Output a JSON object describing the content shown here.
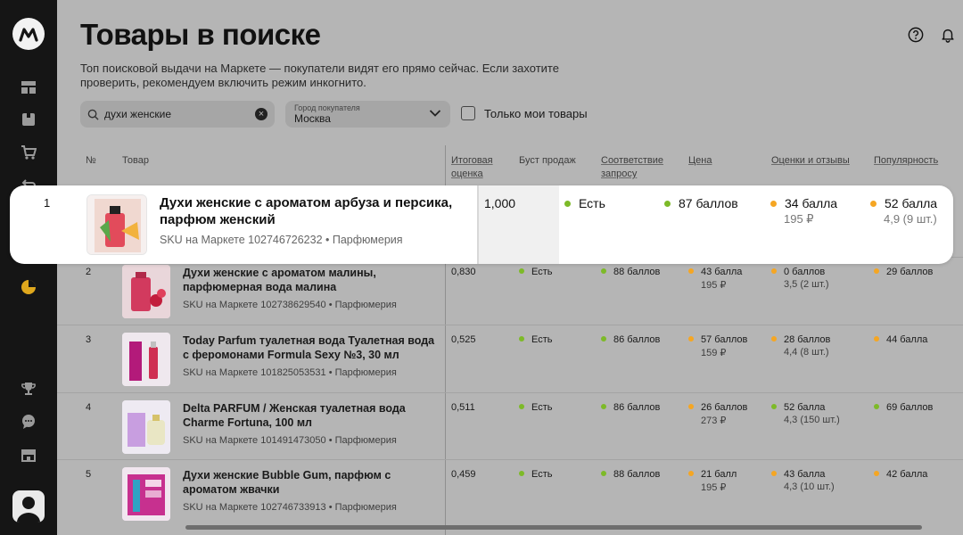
{
  "colors": {
    "green": "#7dba28",
    "orange": "#f5a623",
    "sidebar_bg": "#151515",
    "overlay_bg": "#b5b5b5"
  },
  "sidebar": {
    "logo": "yandex-market-logo",
    "items": [
      {
        "icon": "dashboard-icon"
      },
      {
        "icon": "box-icon"
      },
      {
        "icon": "cart-icon"
      },
      {
        "icon": "returns-icon"
      },
      {
        "icon": "analytics-pie-icon"
      },
      {
        "icon": "trophy-icon"
      },
      {
        "icon": "chat-icon"
      },
      {
        "icon": "store-icon"
      }
    ],
    "avatar": "user-avatar-icon"
  },
  "header": {
    "title": "Товары в поиске",
    "description": "Топ поисковой выдачи на Маркете — покупатели видят его прямо сейчас. Если захотите проверить, рекомендуем включить режим инкогнито.",
    "help_icon": "help-icon",
    "bell_icon": "bell-icon"
  },
  "filters": {
    "search_value": "духи женские",
    "city_label": "Город покупателя",
    "city_value": "Москва",
    "only_mine_label": "Только мои товары",
    "only_mine_checked": false
  },
  "table": {
    "columns": {
      "num": "№",
      "product": "Товар",
      "score": "Итоговая оценка",
      "boost": "Буст продаж",
      "relevance": "Соответствие запросу",
      "price": "Цена",
      "reviews": "Оценки и отзывы",
      "popularity": "Популярность"
    },
    "highlighted": {
      "num": "1",
      "name": "Духи женские с ароматом арбуза и персика, парфюм женский",
      "sku": "SKU на Маркете 102746726232 • Парфюмерия",
      "score": "1,000",
      "boost": "Есть",
      "relevance": "87 баллов",
      "price_points": "34 балла",
      "price_value": "195 ₽",
      "reviews_points": "52 балла",
      "reviews_value": "4,9 (9 шт.)"
    },
    "rows": [
      {
        "num": "2",
        "name": "Духи женские с ароматом малины, парфюмерная вода малина",
        "sku": "SKU на Маркете 102738629540 • Парфюмерия",
        "score": "0,830",
        "boost": "Есть",
        "relevance": "88 баллов",
        "price_points": "43 балла",
        "price_value": "195 ₽",
        "reviews_points": "0 баллов",
        "reviews_value": "3,5 (2 шт.)",
        "popularity": "29 баллов"
      },
      {
        "num": "3",
        "name": "Today Parfum туалетная вода Туалетная вода с феромонами Formula Sexy №3, 30 мл",
        "sku": "SKU на Маркете 101825053531 • Парфюмерия",
        "score": "0,525",
        "boost": "Есть",
        "relevance": "86 баллов",
        "price_points": "57 баллов",
        "price_value": "159 ₽",
        "reviews_points": "28 баллов",
        "reviews_value": "4,4 (8 шт.)",
        "popularity": "44 балла"
      },
      {
        "num": "4",
        "name": "Delta PARFUM / Женская туалетная вода Charme Fortuna, 100 мл",
        "sku": "SKU на Маркете 101491473050 • Парфюмерия",
        "score": "0,511",
        "boost": "Есть",
        "relevance": "86 баллов",
        "price_points": "26 баллов",
        "price_value": "273 ₽",
        "reviews_points": "52 балла",
        "reviews_value": "4,3 (150 шт.)",
        "popularity": "69 баллов"
      },
      {
        "num": "5",
        "name": "Духи женские Bubble Gum, парфюм с ароматом жвачки",
        "sku": "SKU на Маркете 102746733913 • Парфюмерия",
        "score": "0,459",
        "boost": "Есть",
        "relevance": "88 баллов",
        "price_points": "21 балл",
        "price_value": "195 ₽",
        "reviews_points": "43 балла",
        "reviews_value": "4,3 (10 шт.)",
        "popularity": "42 балла"
      }
    ]
  }
}
